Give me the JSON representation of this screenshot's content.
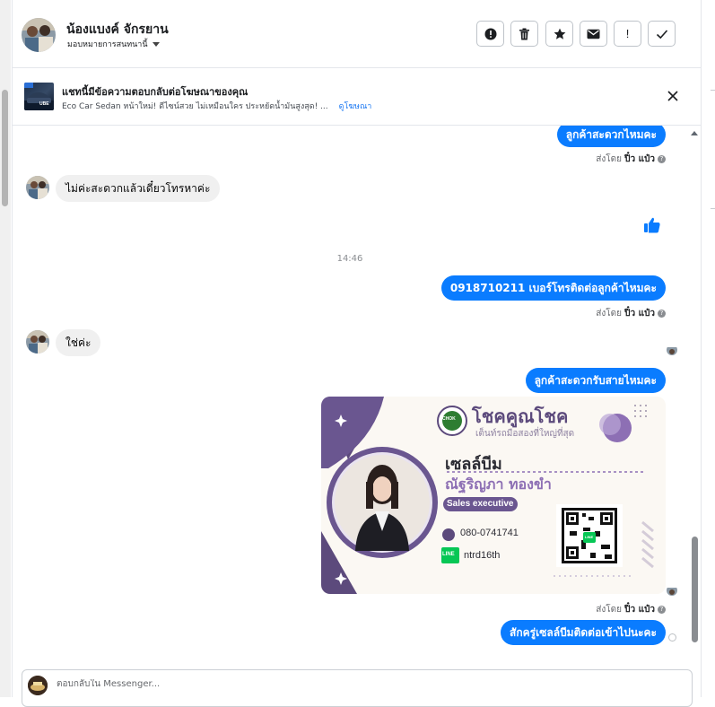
{
  "contact": {
    "name": "น้องแบงค์ จักรยาน",
    "assign_label": "มอบหมายการสนทนานี้"
  },
  "header_actions": [
    {
      "icon": "alert-circle-icon"
    },
    {
      "icon": "trash-icon"
    },
    {
      "icon": "star-icon"
    },
    {
      "icon": "envelope-icon"
    },
    {
      "icon": "exclamation-icon",
      "label": "!"
    },
    {
      "icon": "check-icon"
    }
  ],
  "ad_banner": {
    "title": "แชทนี้มีข้อความตอบกลับต่อโฆษณาของคุณ",
    "subtitle": "Eco Car Sedan หน้าใหม่! ดีไซน์สวย ไม่เหมือนใคร ประหยัดน้ำมันสูงสุด! ...",
    "link": "ดูโฆษณา",
    "thumb_text": "UBE"
  },
  "messages": {
    "m1": "ลูกค้าสะดวกไหมคะ",
    "m2": "ไม่ค่ะสะดวกแล้วเดี๋ยวโทรหาค่ะ",
    "time_divider": "14:46",
    "m3": "0918710211  เบอร์โทรติดต่อลูกค้าไหมคะ",
    "m4": "ใช่ค่ะ",
    "m5": "ลูกค้าสะดวกรับสายไหมคะ",
    "m6": "สักครู่เซลล์บีมติดต่อเข้าไปนะคะ",
    "sent_prefix": "ส่งโดย",
    "sender": "ปิ๋ว แป๋ว",
    "help": "?"
  },
  "card": {
    "brand": "โชคคูณโชค",
    "brand_tagline": "เต็นท์รถมือสองที่ใหญ่ที่สุด",
    "logo_text": "CHOK",
    "name_title": "เซลล์บีม",
    "full_name": "ณัฐริญภา ทองขำ",
    "role": "Sales executive",
    "phone": "080-0741741",
    "line_label": "LINE",
    "line_id": "ntrd16th",
    "qr_label": "LINE"
  },
  "composer": {
    "placeholder": "ตอบกลับใน Messenger..."
  },
  "colors": {
    "outgoing_bubble": "#0a7cff",
    "incoming_bubble": "#f0f0f0",
    "card_purple": "#5c4a7c",
    "link": "#1876f2"
  }
}
